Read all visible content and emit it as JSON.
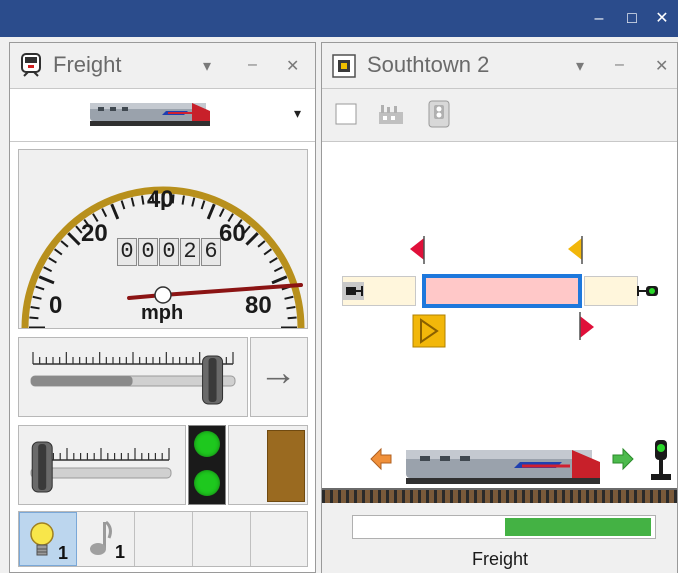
{
  "window": {
    "minimize_glyph": "–",
    "maximize_glyph": "□",
    "close_glyph": "✕"
  },
  "throttle_panel": {
    "title": "Freight",
    "icon": "locomotive-icon",
    "dropdown_glyph": "▾",
    "minimize_glyph": "–",
    "close_glyph": "✕",
    "loco_selector_arrow": "▾",
    "speedometer": {
      "labels": [
        "0",
        "20",
        "40",
        "60",
        "80"
      ],
      "odometer_digits": [
        "0",
        "0",
        "0",
        "2",
        "6"
      ],
      "unit": "mph",
      "needle_speed": 80,
      "max_speed": 80
    },
    "throttle_slider_level": 0.89,
    "direction_arrow": "→",
    "brake_slider_level": 0.08,
    "signal_lights": [
      "#1ec81e",
      "#1ec81e"
    ],
    "functions": [
      {
        "icon": "headlight-icon",
        "badge": "1",
        "active": true
      },
      {
        "icon": "horn-icon",
        "badge": "1",
        "active": false
      },
      {
        "icon": "",
        "badge": "",
        "active": false
      },
      {
        "icon": "",
        "badge": "",
        "active": false
      },
      {
        "icon": "",
        "badge": "",
        "active": false
      }
    ]
  },
  "block_panel": {
    "title": "Southtown 2",
    "icon": "block-icon",
    "dropdown_glyph": "▾",
    "minimize_glyph": "–",
    "close_glyph": "✕",
    "toolbar": [
      "blank-page-icon",
      "industry-icon",
      "signal-panel-icon"
    ],
    "status_progress": 0.5,
    "train_name": "Freight"
  },
  "colors": {
    "accent_blue": "#1e78dc",
    "block_occupied": "#ffc8c8",
    "progress_green": "#44b244",
    "signal_red": "#e0103a",
    "signal_amber": "#f2b70a",
    "arrow_orange": "#f0903a",
    "arrow_green": "#4cba4c",
    "title_bar": "#2b4c8c"
  }
}
